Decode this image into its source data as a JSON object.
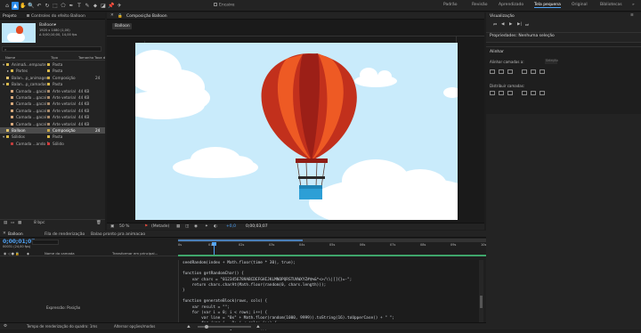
{
  "toolbar": {
    "tools": [
      "⌂",
      "▲",
      "✋",
      "🔍",
      "↶",
      "↻",
      "⬚",
      "⬠",
      "✒",
      "T",
      "✎",
      "⬥",
      "◪",
      "📌",
      "✈"
    ],
    "snap_label": "Encaixe",
    "workspaces": [
      "Padrão",
      "Revisão",
      "Aprendizado",
      "Tela pequena",
      "Original",
      "Bibliotecas"
    ],
    "more": "»"
  },
  "project": {
    "tab_label": "Projeto",
    "effects_tab": "Controles do efeito Balloon",
    "item_name": "Balloon▾",
    "item_info1": "1920 x 1080 (1,00)",
    "item_info2": "Δ 0;00;10;00, 14,00 fps",
    "col_name": "Nome",
    "col_type": "Tipo",
    "col_size": "Tamanho",
    "col_rate": "Taxa d",
    "rows": [
      {
        "indent": 0,
        "exp": "▾",
        "name": "Animaã...empaute",
        "type": "Pasta",
        "size": "",
        "rate": "",
        "color": "#d8b84a"
      },
      {
        "indent": 1,
        "exp": "▸",
        "name": "Partes",
        "type": "Pasta",
        "size": "",
        "rate": "",
        "color": "#d8b84a"
      },
      {
        "indent": 0,
        "exp": "",
        "name": "Balan...p_animagem",
        "type": "Composição",
        "size": "",
        "rate": "24",
        "color": "#e0c26a"
      },
      {
        "indent": 0,
        "exp": "▾",
        "name": "Balan...p_camadas",
        "type": "Pasta",
        "size": "",
        "rate": "",
        "color": "#d8b84a"
      },
      {
        "indent": 1,
        "exp": "",
        "name": "Camada ...gacal",
        "type": "Arte vetorial",
        "size": "44 KB",
        "rate": "",
        "color": "#d6a87b"
      },
      {
        "indent": 1,
        "exp": "",
        "name": "Camada ...gacal",
        "type": "Arte vetorial",
        "size": "44 KB",
        "rate": "",
        "color": "#d6a87b"
      },
      {
        "indent": 1,
        "exp": "",
        "name": "Camada ...gacal",
        "type": "Arte vetorial",
        "size": "44 KB",
        "rate": "",
        "color": "#d6a87b"
      },
      {
        "indent": 1,
        "exp": "",
        "name": "Camada ...gacal",
        "type": "Arte vetorial",
        "size": "44 KB",
        "rate": "",
        "color": "#d6a87b"
      },
      {
        "indent": 1,
        "exp": "",
        "name": "Camada ...gacal",
        "type": "Arte vetorial",
        "size": "44 KB",
        "rate": "",
        "color": "#d6a87b"
      },
      {
        "indent": 1,
        "exp": "",
        "name": "Camada ...gacal",
        "type": "Arte vetorial",
        "size": "44 KB",
        "rate": "",
        "color": "#d6a87b"
      },
      {
        "indent": 0,
        "exp": "",
        "name": "Balloon",
        "type": "Composição",
        "size": "",
        "rate": "24",
        "color": "#e0c26a",
        "selected": true
      },
      {
        "indent": 0,
        "exp": "▾",
        "name": "Sólidos",
        "type": "Pasta",
        "size": "",
        "rate": "",
        "color": "#d8b84a"
      },
      {
        "indent": 1,
        "exp": "",
        "name": "Camada ...ando 1",
        "type": "Sólido",
        "size": "",
        "rate": "",
        "color": "#bf3c3c"
      }
    ],
    "bpc": "8 bpc"
  },
  "composition": {
    "tab_label": "Composição Balloon",
    "breadcrumb": "Balloon",
    "zoom": "50 %",
    "quality": "(Metade)",
    "timecode": "0;00;03;07"
  },
  "right": {
    "preview_title": "Visualização",
    "props_title": "Propriedades: Nenhuma seleção",
    "align_title": "Alinhar",
    "align_layers": "Alinhar camadas a:",
    "align_to": "Seleção",
    "distribute": "Distribuir camadas:"
  },
  "timeline": {
    "tab": "Balloon",
    "render_tab": "Fila de renderização",
    "other_tab": "Balao pronto pra animacao",
    "current_time": "0;00;01;07",
    "frame_info": "00031 (24,00 fps)",
    "col_layer": "Nome da camada",
    "col_parent": "Transformar em principal...",
    "expression": "Expressão: Posição",
    "render_time": "Tempo de renderização do quadro: 1ms",
    "toggle": "Alternar opções/modos",
    "ticks": [
      "0s",
      "01s",
      "02s",
      "03s",
      "04s",
      "05s",
      "06s",
      "07s",
      "08s",
      "09s",
      "10s"
    ],
    "code": [
      "seedRandom(index + Math.floor(time * 30), true);",
      "",
      "function getRandomChar() {",
      "    var chars = \"0123456789ABCDEFGHIJKLMNOPQRSTUVWXYZ#$%&*<>/\\\\|[]{}=-\";",
      "    return chars.charAt(Math.floor(random(0, chars.length)));",
      "}",
      "",
      "function generateBlock(rows, cols) {",
      "    var result = \"\";",
      "    for (var i = 0; i < rows; i++) {",
      "        var line = \"0x\" + Math.floor(random(1000, 9999)).toString(16).toUpperCase() + \" \";",
      "        for (var j = 0; j < cols; j++) {",
      "            line += getRandomChar();"
    ]
  },
  "colors": {
    "accent": "#2d8ceb",
    "sky": "#c9ebfb",
    "balloon_dark": "#c2301c",
    "balloon_light": "#ee5a24",
    "basket": "#2d9fd6"
  },
  "icons": [
    "home-icon",
    "selection-icon",
    "hand-icon",
    "zoom-icon",
    "search-icon",
    "stopwatch-icon",
    "play-icon",
    "graph-icon"
  ]
}
